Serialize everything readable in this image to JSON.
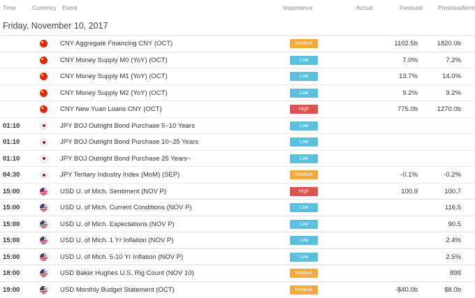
{
  "header": {
    "time": "Time",
    "currency": "Currency",
    "event": "Event",
    "importance": "Importance",
    "actual": "Actual",
    "forecast": "Forecast",
    "previous": "Previous",
    "alerts": "Alerts"
  },
  "date_label": "Friday, November 10, 2017",
  "colors": {
    "medium": "#f4a93d",
    "low": "#5bc0de",
    "high": "#d9534f"
  },
  "flags": {
    "cn": "china-flag-icon",
    "jp": "japan-flag-icon",
    "us": "usa-flag-icon"
  },
  "rows": [
    {
      "time": "",
      "flag": "cn",
      "event": "CNY Aggregate Financing CNY (OCT)",
      "importance": "Medium",
      "actual": "",
      "forecast": "1102.5b",
      "previous": "1820.0b"
    },
    {
      "time": "",
      "flag": "cn",
      "event": "CNY Money Supply M0 (YoY) (OCT)",
      "importance": "Low",
      "actual": "",
      "forecast": "7.0%",
      "previous": "7.2%"
    },
    {
      "time": "",
      "flag": "cn",
      "event": "CNY Money Supply M1 (YoY) (OCT)",
      "importance": "Low",
      "actual": "",
      "forecast": "13.7%",
      "previous": "14.0%"
    },
    {
      "time": "",
      "flag": "cn",
      "event": "CNY Money Supply M2 (YoY) (OCT)",
      "importance": "Low",
      "actual": "",
      "forecast": "9.2%",
      "previous": "9.2%"
    },
    {
      "time": "",
      "flag": "cn",
      "event": "CNY New Yuan Loans CNY (OCT)",
      "importance": "High",
      "actual": "",
      "forecast": "775.0b",
      "previous": "1270.0b"
    },
    {
      "time": "01:10",
      "flag": "jp",
      "event": "JPY BOJ Outright Bond Purchase 5~10 Years",
      "importance": "Low",
      "actual": "",
      "forecast": "",
      "previous": ""
    },
    {
      "time": "01:10",
      "flag": "jp",
      "event": "JPY BOJ Outright Bond Purchase 10~25 Years",
      "importance": "Low",
      "actual": "",
      "forecast": "",
      "previous": ""
    },
    {
      "time": "01:10",
      "flag": "jp",
      "event": "JPY BOJ Outright Bond Purchase 25 Years~",
      "importance": "Low",
      "actual": "",
      "forecast": "",
      "previous": ""
    },
    {
      "time": "04:30",
      "flag": "jp",
      "event": "JPY Tertiary Industry Index (MoM) (SEP)",
      "importance": "Medium",
      "actual": "",
      "forecast": "-0.1%",
      "previous": "-0.2%"
    },
    {
      "time": "15:00",
      "flag": "us",
      "event": "USD U. of Mich. Sentiment (NOV P)",
      "importance": "High",
      "actual": "",
      "forecast": "100.9",
      "previous": "100.7"
    },
    {
      "time": "15:00",
      "flag": "us",
      "event": "USD U. of Mich. Current Conditions (NOV P)",
      "importance": "Low",
      "actual": "",
      "forecast": "",
      "previous": "116.5"
    },
    {
      "time": "15:00",
      "flag": "us",
      "event": "USD U. of Mich. Expectations (NOV P)",
      "importance": "Low",
      "actual": "",
      "forecast": "",
      "previous": "90.5"
    },
    {
      "time": "15:00",
      "flag": "us",
      "event": "USD U. of Mich. 1 Yr Inflation (NOV P)",
      "importance": "Low",
      "actual": "",
      "forecast": "",
      "previous": "2.4%"
    },
    {
      "time": "15:00",
      "flag": "us",
      "event": "USD U. of Mich. 5-10 Yr Inflation (NOV P)",
      "importance": "Low",
      "actual": "",
      "forecast": "",
      "previous": "2.5%"
    },
    {
      "time": "18:00",
      "flag": "us",
      "event": "USD Baker Hughes U.S. Rig Count (NOV 10)",
      "importance": "Medium",
      "actual": "",
      "forecast": "",
      "previous": "898"
    },
    {
      "time": "19:00",
      "flag": "us",
      "event": "USD Monthly Budget Statement (OCT)",
      "importance": "Medium",
      "actual": "",
      "forecast": "-$40.0b",
      "previous": "$8.0b"
    }
  ]
}
